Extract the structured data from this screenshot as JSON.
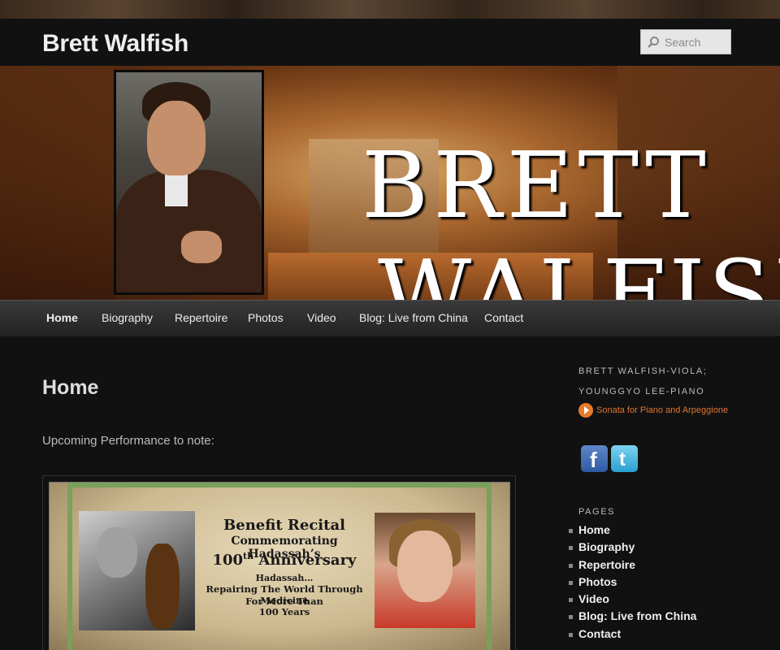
{
  "header": {
    "site_title": "Brett Walfish",
    "search_placeholder": "Search"
  },
  "banner": {
    "line1": "Brett",
    "line2": "Walfish"
  },
  "nav": {
    "items": [
      "Home",
      "Biography",
      "Repertoire",
      "Photos",
      "Video",
      "Blog: Live from China",
      "Contact"
    ],
    "active": "Home"
  },
  "main": {
    "title": "Home",
    "intro": "Upcoming Performance to note:",
    "flyer": {
      "line1": "Benefit Recital",
      "line2": "Commemorating Hadassah’s",
      "line3_number": "100",
      "line3_suffix": "th",
      "line3_rest": "Anniversary",
      "line4": "Hadassah…",
      "line5": "Repairing The World Through Medicine",
      "line6": "For More Than",
      "line7": "100 Years"
    }
  },
  "sidebar": {
    "widget_title_1": "Brett Walfish-Viola;",
    "widget_title_2": "Younggyo Lee-Piano",
    "track_link": "Sonata for Piano and Arpeggione",
    "pages_title": "Pages",
    "pages": [
      "Home",
      "Biography",
      "Repertoire",
      "Photos",
      "Video",
      "Blog: Live from China",
      "Contact"
    ]
  },
  "colors": {
    "background": "#111111",
    "accent_link": "#e07530",
    "nav_bar": "#2e2e2e"
  },
  "icons": {
    "search": "search-icon",
    "play": "play-icon",
    "facebook": "facebook-icon",
    "twitter": "twitter-icon"
  }
}
